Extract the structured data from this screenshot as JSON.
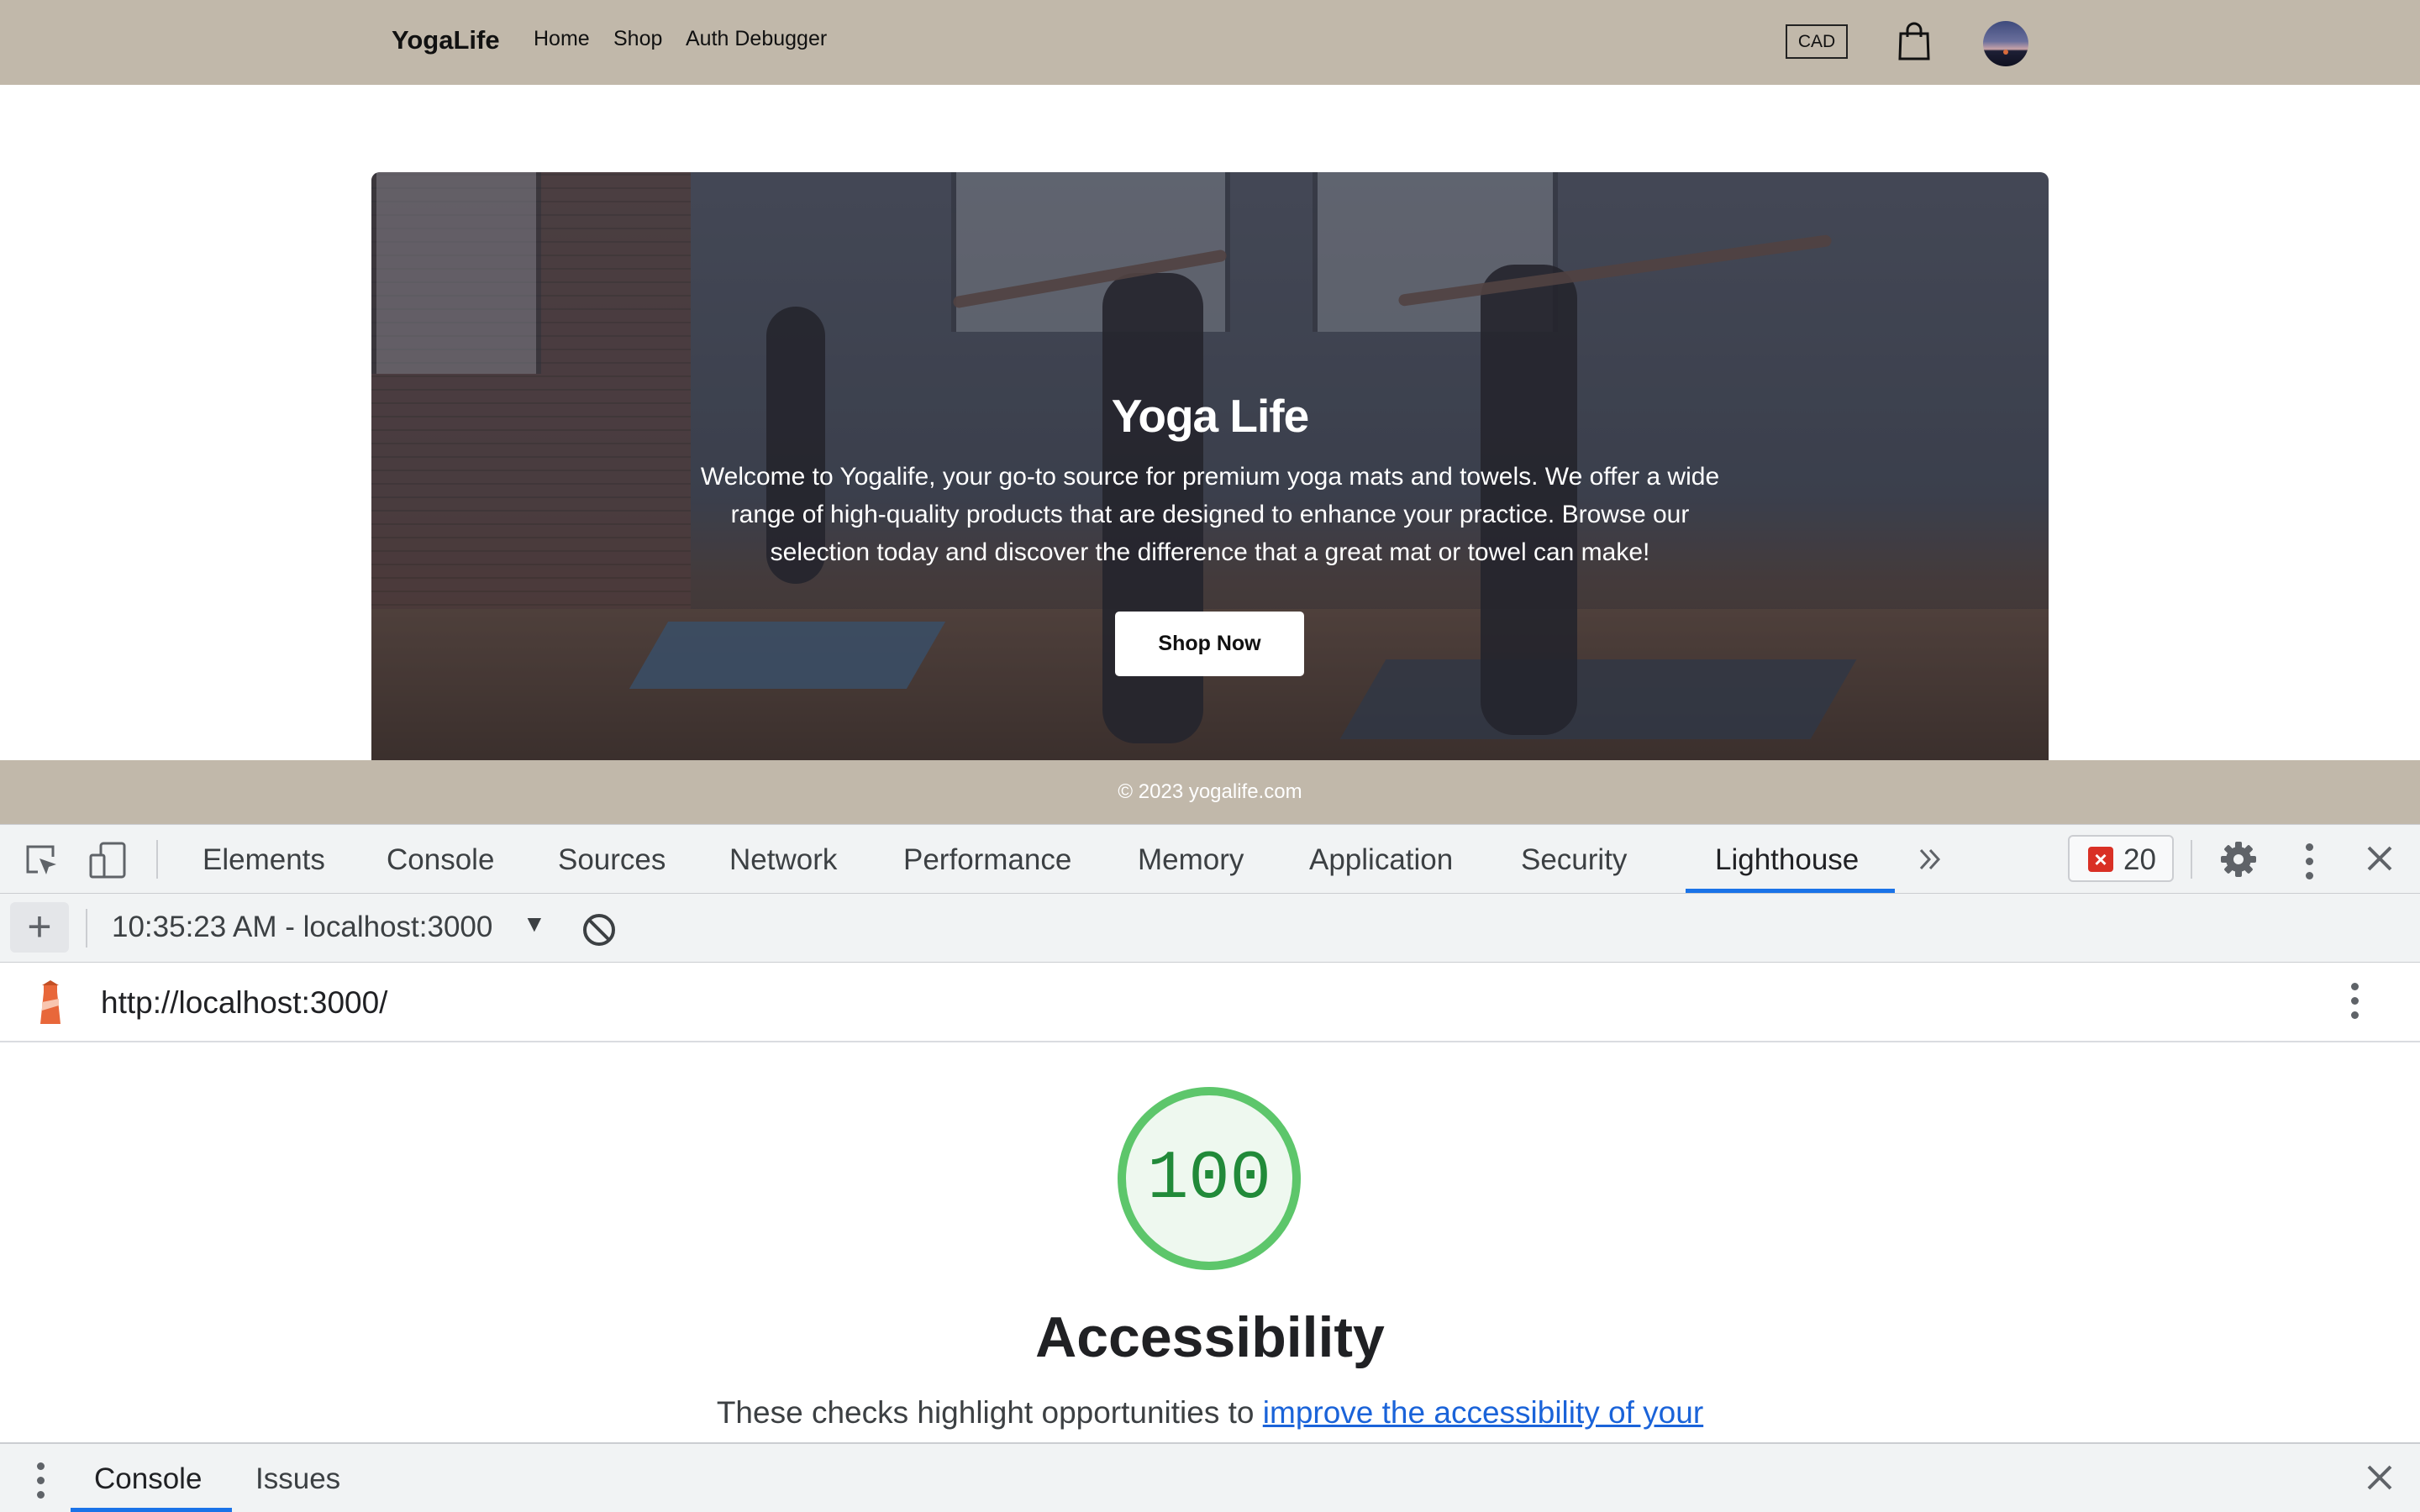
{
  "site": {
    "brand": "YogaLife",
    "nav": [
      "Home",
      "Shop",
      "Auth Debugger"
    ],
    "currency": "CAD",
    "hero": {
      "title": "Yoga Life",
      "text": "Welcome to Yogalife, your go-to source for premium yoga mats and towels. We offer a wide range of high-quality products that are designed to enhance your practice. Browse our selection today and discover the difference that a great mat or towel can make!",
      "button": "Shop Now"
    },
    "footer": "© 2023 yogalife.com"
  },
  "devtools": {
    "tabs": [
      "Elements",
      "Console",
      "Sources",
      "Network",
      "Performance",
      "Memory",
      "Application",
      "Security",
      "Lighthouse"
    ],
    "active_tab": "Lighthouse",
    "error_count": "20",
    "report_label": "10:35:23 AM - localhost:3000",
    "url": "http://localhost:3000/",
    "score": "100",
    "category": "Accessibility",
    "description_prefix": "These checks highlight opportunities to ",
    "description_link": "improve the accessibility of your",
    "drawer_tabs": [
      "Console",
      "Issues"
    ],
    "colors": {
      "accent": "#1a73e8",
      "pass": "#0cce6b",
      "error": "#d93025"
    }
  }
}
